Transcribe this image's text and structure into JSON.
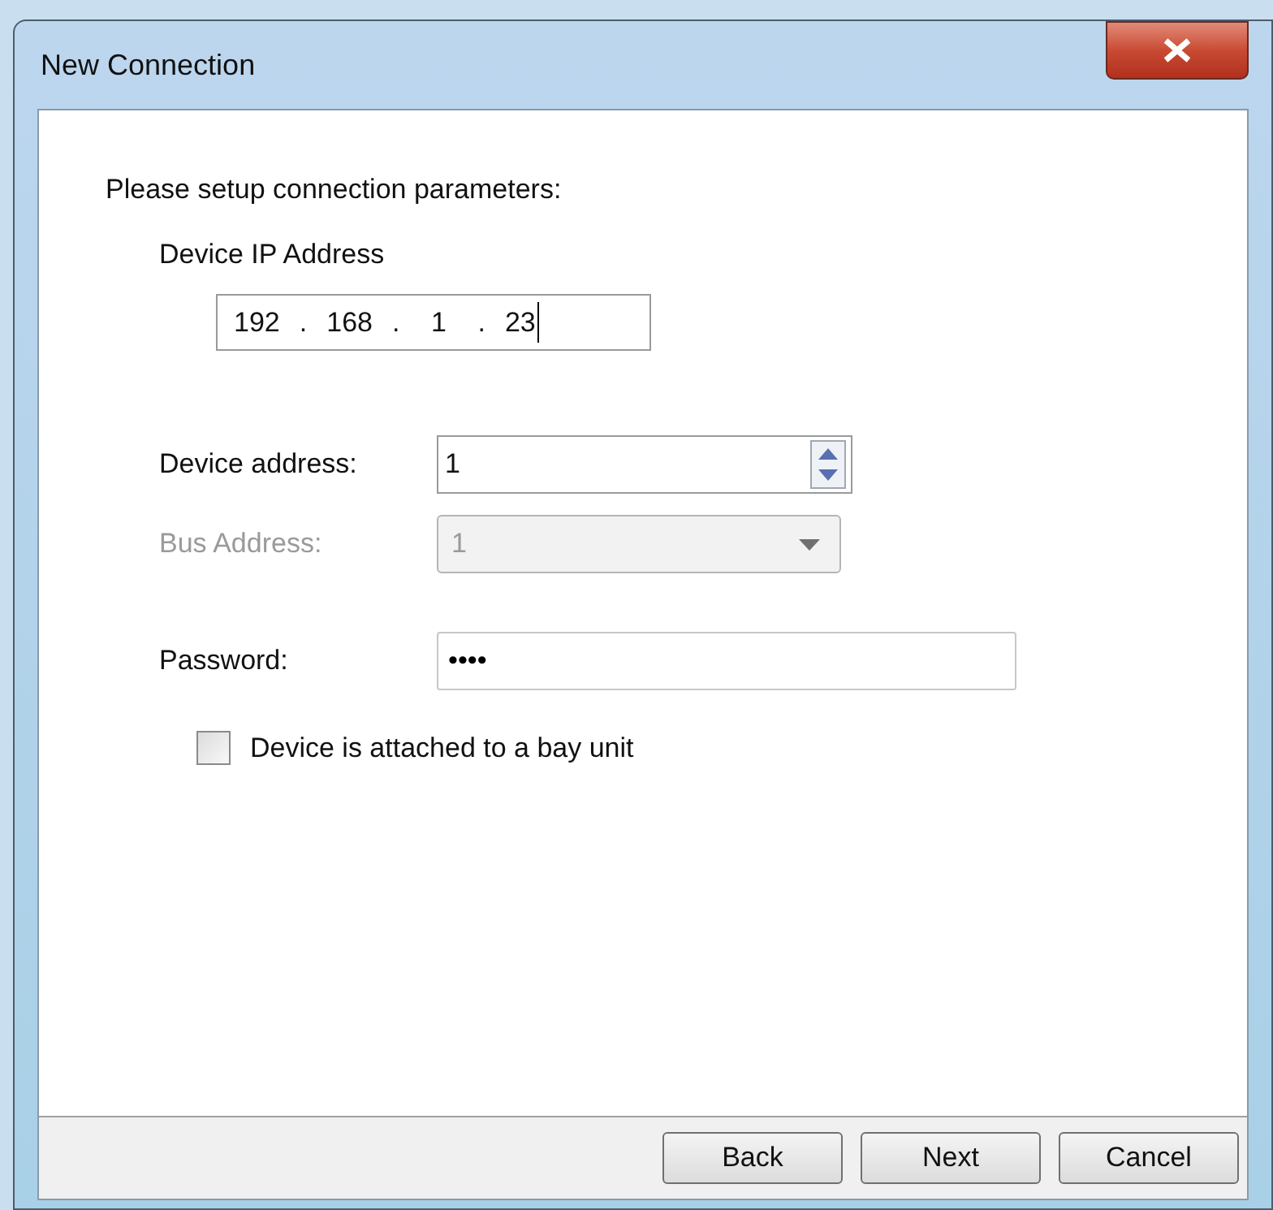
{
  "window": {
    "title": "New Connection"
  },
  "intro": "Please setup connection parameters:",
  "ip": {
    "label": "Device IP Address",
    "octets": [
      "192",
      "168",
      "1",
      "23"
    ],
    "separator": "."
  },
  "device_address": {
    "label": "Device address:",
    "value": "1",
    "disabled": false
  },
  "bus_address": {
    "label": "Bus Address:",
    "value": "1",
    "disabled": true
  },
  "password": {
    "label": "Password:",
    "value": "••••"
  },
  "bay_unit": {
    "label": "Device is attached to a bay unit",
    "checked": false
  },
  "buttons": [
    "Back",
    "Next",
    "Cancel"
  ]
}
